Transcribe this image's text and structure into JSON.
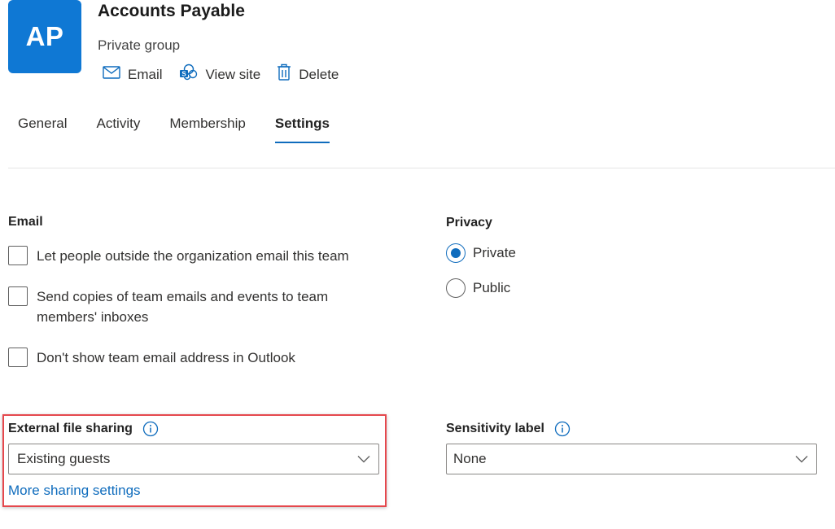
{
  "group": {
    "initials": "AP",
    "name": "Accounts Payable",
    "type": "Private group",
    "avatar_color": "#0f78d4"
  },
  "actions": [
    {
      "label": "Email",
      "icon": "mail-icon"
    },
    {
      "label": "View site",
      "icon": "sharepoint-icon"
    },
    {
      "label": "Delete",
      "icon": "trash-icon"
    }
  ],
  "tabs": [
    {
      "label": "General",
      "active": false
    },
    {
      "label": "Activity",
      "active": false
    },
    {
      "label": "Membership",
      "active": false
    },
    {
      "label": "Settings",
      "active": true
    }
  ],
  "email": {
    "heading": "Email",
    "options": [
      {
        "label": "Let people outside the organization email this team",
        "checked": false
      },
      {
        "label": "Send copies of team emails and events to team members' inboxes",
        "checked": false
      },
      {
        "label": "Don't show team email address in Outlook",
        "checked": false
      }
    ]
  },
  "privacy": {
    "heading": "Privacy",
    "options": [
      {
        "label": "Private",
        "selected": true
      },
      {
        "label": "Public",
        "selected": false
      }
    ]
  },
  "external_sharing": {
    "heading": "External file sharing",
    "value": "Existing guests",
    "link": "More sharing settings"
  },
  "sensitivity": {
    "heading": "Sensitivity label",
    "value": "None"
  },
  "colors": {
    "accent": "#0f6cbd",
    "highlight_border": "#e5484d"
  }
}
